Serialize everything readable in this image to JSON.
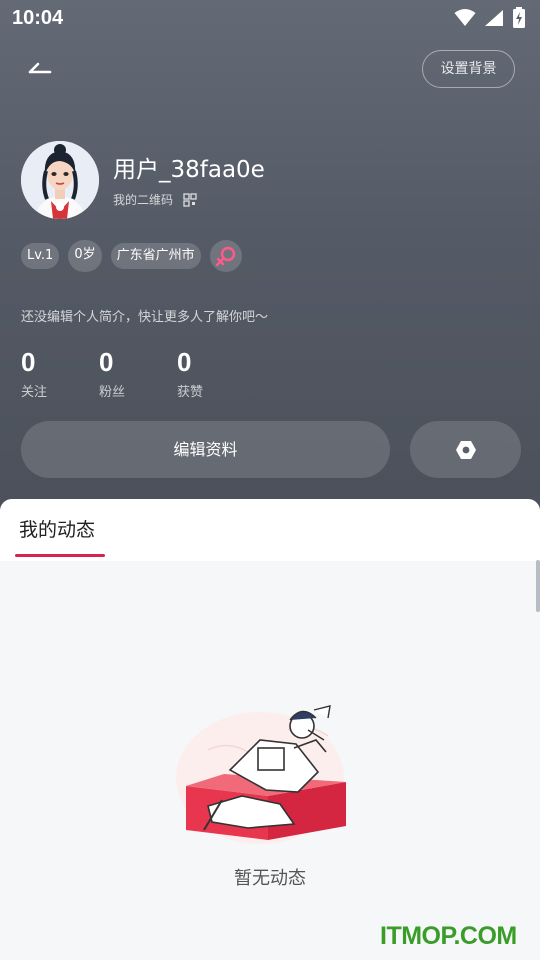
{
  "status_bar": {
    "time": "10:04"
  },
  "header": {
    "background_button": "设置背景"
  },
  "profile": {
    "username": "用户_38faa0e",
    "qr_label": "我的二维码",
    "tags": {
      "level": "Lv.1",
      "age": "0岁",
      "location": "广东省广州市"
    },
    "gender_icon": "female-icon",
    "bio": "还没编辑个人简介，快让更多人了解你吧～",
    "stats": [
      {
        "value": "0",
        "label": "关注"
      },
      {
        "value": "0",
        "label": "粉丝"
      },
      {
        "value": "0",
        "label": "获赞"
      }
    ],
    "edit_button": "编辑资料",
    "settings_icon": "settings-icon"
  },
  "feed": {
    "tab_label": "我的动态",
    "empty_text": "暂无动态"
  },
  "watermark": "ITMOP.COM",
  "colors": {
    "accent": "#d8244a",
    "header_bg": "#5a606b",
    "watermark": "#3a9d2a"
  }
}
